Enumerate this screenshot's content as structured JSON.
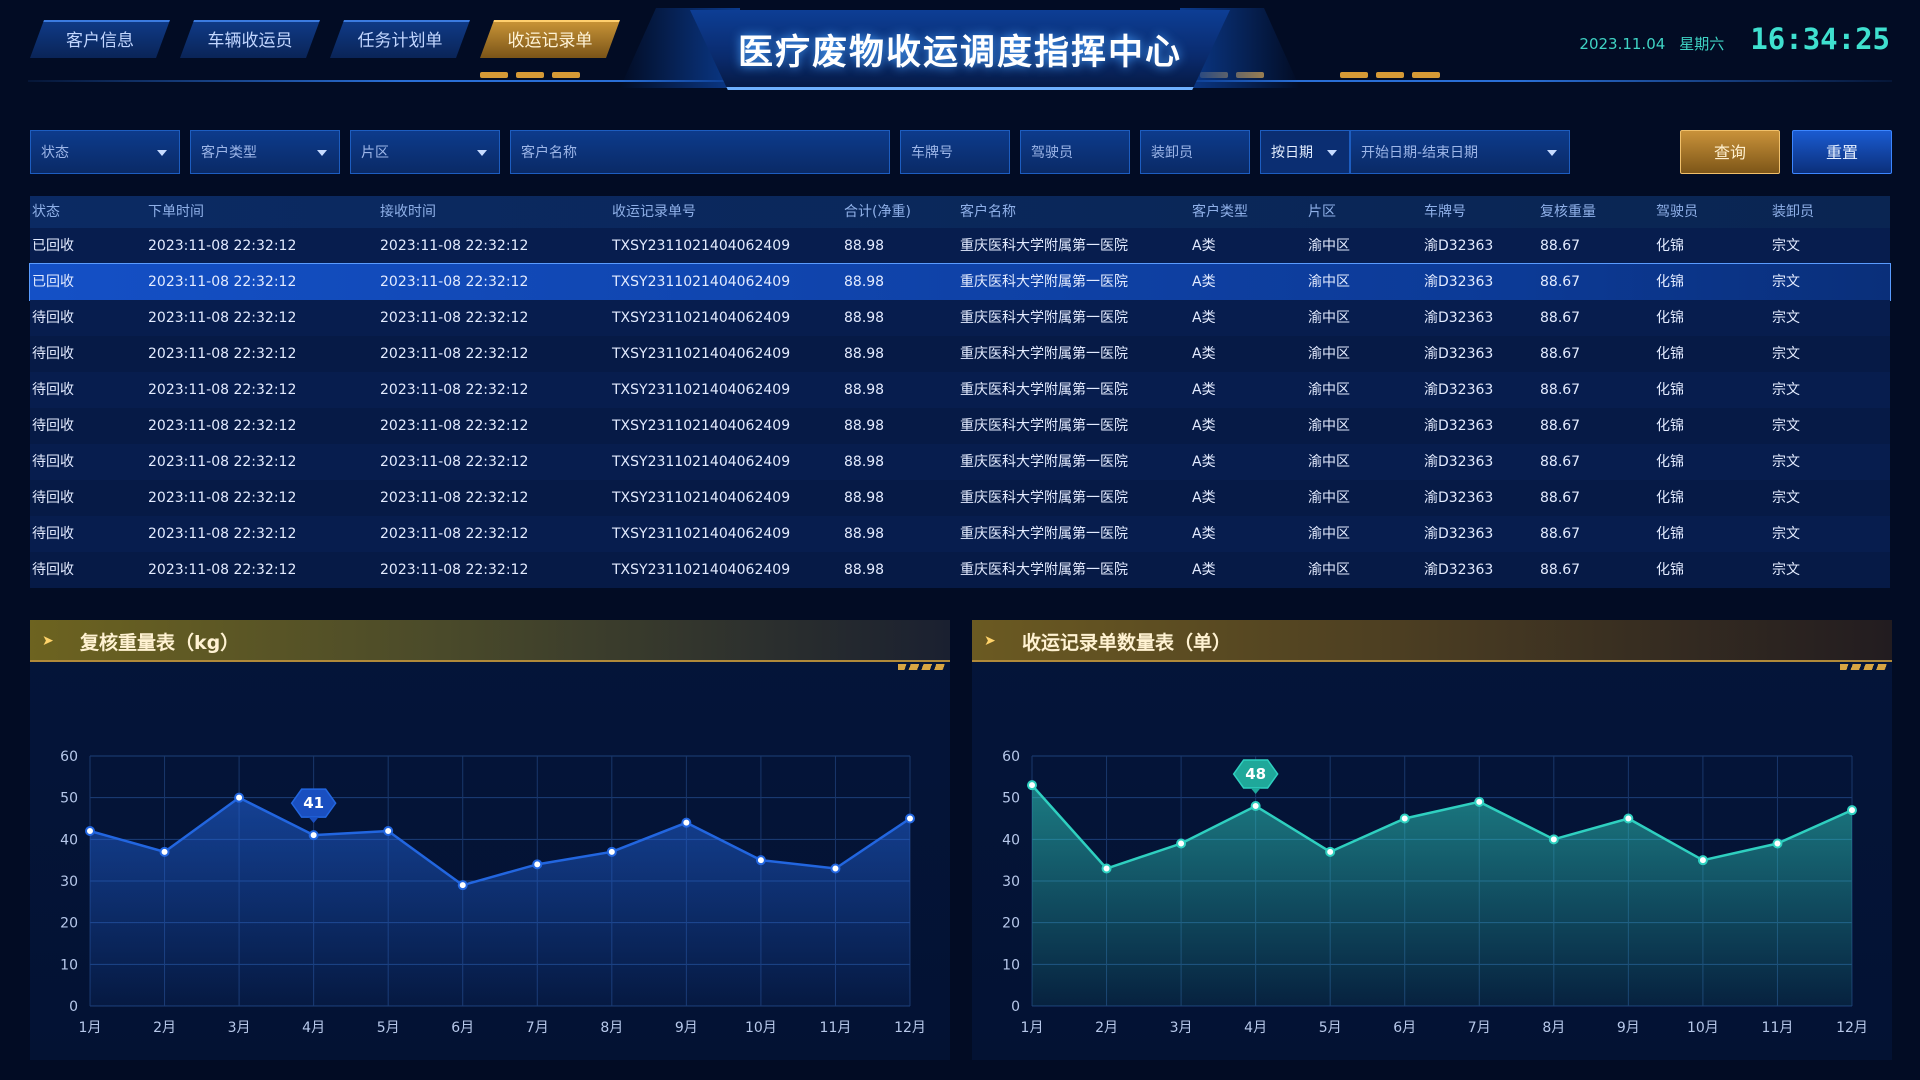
{
  "header": {
    "tabs": [
      {
        "label": "客户信息",
        "active": false
      },
      {
        "label": "车辆收运员",
        "active": false
      },
      {
        "label": "任务计划单",
        "active": false
      },
      {
        "label": "收运记录单",
        "active": true
      }
    ],
    "title": "医疗废物收运调度指挥中心",
    "date": "2023.11.04",
    "weekday": "星期六",
    "time": "16:34:25"
  },
  "filters": {
    "status": "状态",
    "customer_type": "客户类型",
    "area": "片区",
    "customer_name": "客户名称",
    "plate": "车牌号",
    "driver": "驾驶员",
    "loader": "装卸员",
    "date_mode": "按日期",
    "date_range": "开始日期-结束日期",
    "query": "查询",
    "reset": "重置"
  },
  "table": {
    "columns": [
      "状态",
      "下单时间",
      "接收时间",
      "收运记录单号",
      "合计(净重)",
      "客户名称",
      "客户类型",
      "片区",
      "车牌号",
      "复核重量",
      "驾驶员",
      "装卸员"
    ],
    "rows": [
      [
        "已回收",
        "2023:11-08 22:32:12",
        "2023:11-08 22:32:12",
        "TXSY2311021404062409",
        "88.98",
        "重庆医科大学附属第一医院",
        "A类",
        "渝中区",
        "渝D32363",
        "88.67",
        "化锦",
        "宗文"
      ],
      [
        "已回收",
        "2023:11-08 22:32:12",
        "2023:11-08 22:32:12",
        "TXSY2311021404062409",
        "88.98",
        "重庆医科大学附属第一医院",
        "A类",
        "渝中区",
        "渝D32363",
        "88.67",
        "化锦",
        "宗文"
      ],
      [
        "待回收",
        "2023:11-08 22:32:12",
        "2023:11-08 22:32:12",
        "TXSY2311021404062409",
        "88.98",
        "重庆医科大学附属第一医院",
        "A类",
        "渝中区",
        "渝D32363",
        "88.67",
        "化锦",
        "宗文"
      ],
      [
        "待回收",
        "2023:11-08 22:32:12",
        "2023:11-08 22:32:12",
        "TXSY2311021404062409",
        "88.98",
        "重庆医科大学附属第一医院",
        "A类",
        "渝中区",
        "渝D32363",
        "88.67",
        "化锦",
        "宗文"
      ],
      [
        "待回收",
        "2023:11-08 22:32:12",
        "2023:11-08 22:32:12",
        "TXSY2311021404062409",
        "88.98",
        "重庆医科大学附属第一医院",
        "A类",
        "渝中区",
        "渝D32363",
        "88.67",
        "化锦",
        "宗文"
      ],
      [
        "待回收",
        "2023:11-08 22:32:12",
        "2023:11-08 22:32:12",
        "TXSY2311021404062409",
        "88.98",
        "重庆医科大学附属第一医院",
        "A类",
        "渝中区",
        "渝D32363",
        "88.67",
        "化锦",
        "宗文"
      ],
      [
        "待回收",
        "2023:11-08 22:32:12",
        "2023:11-08 22:32:12",
        "TXSY2311021404062409",
        "88.98",
        "重庆医科大学附属第一医院",
        "A类",
        "渝中区",
        "渝D32363",
        "88.67",
        "化锦",
        "宗文"
      ],
      [
        "待回收",
        "2023:11-08 22:32:12",
        "2023:11-08 22:32:12",
        "TXSY2311021404062409",
        "88.98",
        "重庆医科大学附属第一医院",
        "A类",
        "渝中区",
        "渝D32363",
        "88.67",
        "化锦",
        "宗文"
      ],
      [
        "待回收",
        "2023:11-08 22:32:12",
        "2023:11-08 22:32:12",
        "TXSY2311021404062409",
        "88.98",
        "重庆医科大学附属第一医院",
        "A类",
        "渝中区",
        "渝D32363",
        "88.67",
        "化锦",
        "宗文"
      ],
      [
        "待回收",
        "2023:11-08 22:32:12",
        "2023:11-08 22:32:12",
        "TXSY2311021404062409",
        "88.98",
        "重庆医科大学附属第一医院",
        "A类",
        "渝中区",
        "渝D32363",
        "88.67",
        "化锦",
        "宗文"
      ]
    ],
    "selected_row": 1
  },
  "panels": {
    "left_title": "复核重量表（kg）",
    "right_title": "收运记录单数量表（单）"
  },
  "colors": {
    "accent_blue": "#2266e0",
    "accent_teal": "#2fd0c0",
    "accent_gold": "#d69a36"
  },
  "chart_data": [
    {
      "type": "area",
      "title": "复核重量表（kg）",
      "categories": [
        "1月",
        "2月",
        "3月",
        "4月",
        "5月",
        "6月",
        "7月",
        "8月",
        "9月",
        "10月",
        "11月",
        "12月"
      ],
      "series": [
        {
          "values": [
            42,
            37,
            50,
            41,
            42,
            29,
            34,
            37,
            44,
            35,
            33,
            45
          ]
        }
      ],
      "ylim": [
        0,
        60
      ],
      "yticks": [
        0,
        10,
        20,
        30,
        40,
        50,
        60
      ],
      "highlight": {
        "index": 3,
        "label": "41"
      },
      "grid": true,
      "color": "#2266e0"
    },
    {
      "type": "area",
      "title": "收运记录单数量表（单）",
      "categories": [
        "1月",
        "2月",
        "3月",
        "4月",
        "5月",
        "6月",
        "7月",
        "8月",
        "9月",
        "10月",
        "11月",
        "12月"
      ],
      "series": [
        {
          "values": [
            53,
            33,
            39,
            48,
            37,
            45,
            49,
            40,
            45,
            35,
            39,
            47
          ]
        }
      ],
      "ylim": [
        0,
        60
      ],
      "yticks": [
        0,
        10,
        20,
        30,
        40,
        50,
        60
      ],
      "highlight": {
        "index": 3,
        "label": "48"
      },
      "grid": true,
      "color": "#2fd0c0"
    }
  ]
}
